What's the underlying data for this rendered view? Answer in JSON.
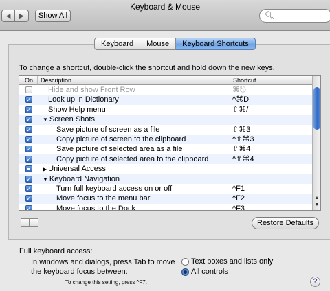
{
  "window": {
    "title": "Keyboard & Mouse"
  },
  "toolbar": {
    "show_all": "Show All",
    "search_placeholder": ""
  },
  "tabs": [
    "Keyboard",
    "Mouse",
    "Keyboard Shortcuts"
  ],
  "active_tab": "Keyboard Shortcuts",
  "instruction": "To change a shortcut, double-click the shortcut and hold down the new keys.",
  "table": {
    "columns": {
      "on": "On",
      "description": "Description",
      "shortcut": "Shortcut"
    },
    "rows": [
      {
        "state": "off",
        "indent": 1,
        "group": false,
        "disabled": true,
        "description": "Hide and show Front Row",
        "shortcut": "⌘⎋"
      },
      {
        "state": "on",
        "indent": 1,
        "group": false,
        "description": "Look up in Dictionary",
        "shortcut": "^⌘D"
      },
      {
        "state": "on",
        "indent": 1,
        "group": false,
        "description": "Show Help menu",
        "shortcut": "⇧⌘/"
      },
      {
        "state": "on",
        "indent": 0,
        "group": true,
        "expanded": true,
        "description": "Screen Shots",
        "shortcut": ""
      },
      {
        "state": "on",
        "indent": 2,
        "group": false,
        "description": "Save picture of screen as a file",
        "shortcut": "⇧⌘3"
      },
      {
        "state": "on",
        "indent": 2,
        "group": false,
        "description": "Copy picture of screen to the clipboard",
        "shortcut": "^⇧⌘3"
      },
      {
        "state": "on",
        "indent": 2,
        "group": false,
        "description": "Save picture of selected area as a file",
        "shortcut": "⇧⌘4"
      },
      {
        "state": "on",
        "indent": 2,
        "group": false,
        "description": "Copy picture of selected area to the clipboard",
        "shortcut": "^⇧⌘4"
      },
      {
        "state": "mixed",
        "indent": 0,
        "group": true,
        "expanded": false,
        "description": "Universal Access",
        "shortcut": ""
      },
      {
        "state": "on",
        "indent": 0,
        "group": true,
        "expanded": true,
        "description": "Keyboard Navigation",
        "shortcut": ""
      },
      {
        "state": "on",
        "indent": 2,
        "group": false,
        "description": "Turn full keyboard access on or off",
        "shortcut": "^F1"
      },
      {
        "state": "on",
        "indent": 2,
        "group": false,
        "description": "Move focus to the menu bar",
        "shortcut": "^F2"
      },
      {
        "state": "on",
        "indent": 2,
        "group": false,
        "description": "Move focus to the Dock",
        "shortcut": "^F3"
      }
    ]
  },
  "buttons": {
    "add": "+",
    "remove": "−",
    "restore_defaults": "Restore Defaults"
  },
  "full_keyboard_access": {
    "heading": "Full keyboard access:",
    "prompt_line1": "In windows and dialogs, press Tab to move",
    "prompt_line2": "the keyboard focus between:",
    "options": [
      "Text boxes and lists only",
      "All controls"
    ],
    "selected": "All controls",
    "note": "To change this setting, press ^F7."
  },
  "help_label": "?"
}
